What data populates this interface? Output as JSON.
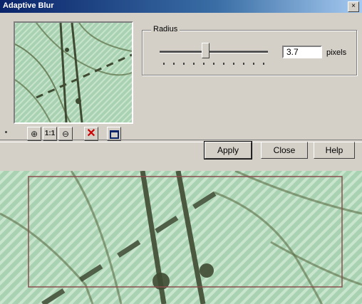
{
  "window": {
    "title": "Adaptive Blur"
  },
  "radius": {
    "group_label": "Radius",
    "value": "3.7",
    "units": "pixels",
    "slider_fraction": 0.42
  },
  "toolbar": {
    "zoom_in": "zoom-in-icon",
    "actual_size": "actual-size-icon",
    "zoom_out": "zoom-out-icon",
    "cancel": "close-red-x-icon",
    "toggle_preview": "window-icon"
  },
  "buttons": {
    "apply": "Apply",
    "close": "Close",
    "help": "Help"
  },
  "colors": {
    "titlebar_start": "#0a246a",
    "map_green": "#a9d3b3",
    "contour": "#5b6d45",
    "cancel_red": "#cc0000"
  }
}
